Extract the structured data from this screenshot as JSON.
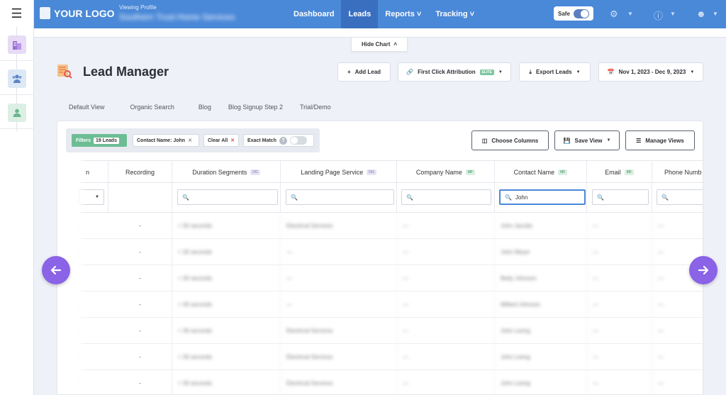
{
  "topnav": {
    "logo_text": "YOUR LOGO",
    "viewing_label": "Viewing Profile",
    "profile_name": "Southern Trust Home Services",
    "links": [
      "Dashboard",
      "Leads",
      "Reports",
      "Tracking"
    ],
    "active_link": "Leads",
    "safe_label": "Safe",
    "accent": "#4a88d8"
  },
  "hide_chart_label": "Hide Chart",
  "header": {
    "title": "Lead Manager",
    "add_lead": "Add Lead",
    "first_click": "First Click Attribution",
    "elite_badge": "ELITE",
    "export": "Export Leads",
    "date_range": "Nov 1, 2023 - Dec 9, 2023"
  },
  "view_tabs": [
    "Default View",
    "Organic Search",
    "Blog",
    "Blog Signup Step 2",
    "Trial/Demo"
  ],
  "filters": {
    "label": "Filters",
    "count": "19 Leads",
    "chip": "Contact Name: John",
    "clear_all": "Clear All",
    "exact_match": "Exact Match",
    "exact_help": "?"
  },
  "controls": {
    "choose_columns": "Choose Columns",
    "save_view": "Save View",
    "manage_views": "Manage Views"
  },
  "columns": [
    {
      "label": "n",
      "tag": ""
    },
    {
      "label": "Recording",
      "tag": ""
    },
    {
      "label": "Duration Segments",
      "tag": "DG"
    },
    {
      "label": "Landing Page Service",
      "tag": "DG"
    },
    {
      "label": "Company Name",
      "tag": "MF"
    },
    {
      "label": "Contact Name",
      "tag": "MF"
    },
    {
      "label": "Email",
      "tag": "MF"
    },
    {
      "label": "Phone Numb",
      "tag": ""
    }
  ],
  "contact_filter_value": "John",
  "rows": [
    {
      "recording": "-",
      "duration": "< 30 seconds",
      "landing": "Electrical Services",
      "company": "—",
      "contact": "John Jacobs",
      "email": "—",
      "phone": "—"
    },
    {
      "recording": "-",
      "duration": "< 30 seconds",
      "landing": "—",
      "company": "—",
      "contact": "John Meyer",
      "email": "—",
      "phone": "—"
    },
    {
      "recording": "-",
      "duration": "< 30 seconds",
      "landing": "—",
      "company": "—",
      "contact": "Betty Johnson",
      "email": "—",
      "phone": "—"
    },
    {
      "recording": "-",
      "duration": "< 30 seconds",
      "landing": "—",
      "company": "—",
      "contact": "Millard Johnson",
      "email": "—",
      "phone": "—"
    },
    {
      "recording": "-",
      "duration": "< 30 seconds",
      "landing": "Electrical Services",
      "company": "—",
      "contact": "John Leeng",
      "email": "—",
      "phone": "—"
    },
    {
      "recording": "-",
      "duration": "< 30 seconds",
      "landing": "Electrical Services",
      "company": "—",
      "contact": "John Leeng",
      "email": "—",
      "phone": "—"
    },
    {
      "recording": "-",
      "duration": "< 30 seconds",
      "landing": "Electrical Services",
      "company": "—",
      "contact": "John Leeng",
      "email": "—",
      "phone": "—"
    }
  ]
}
